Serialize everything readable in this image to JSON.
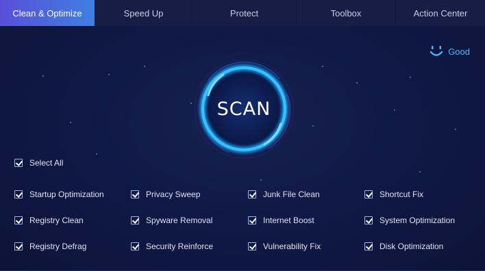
{
  "tabs": [
    {
      "label": "Clean & Optimize"
    },
    {
      "label": "Speed Up"
    },
    {
      "label": "Protect"
    },
    {
      "label": "Toolbox"
    },
    {
      "label": "Action Center"
    }
  ],
  "status": {
    "label": "Good",
    "icon": "smiley-icon",
    "color": "#4fb6ff"
  },
  "scan": {
    "label": "SCAN"
  },
  "select_all": {
    "label": "Select All",
    "checked": true
  },
  "options": [
    {
      "label": "Startup Optimization",
      "checked": true
    },
    {
      "label": "Privacy Sweep",
      "checked": true
    },
    {
      "label": "Junk File Clean",
      "checked": true
    },
    {
      "label": "Shortcut Fix",
      "checked": true
    },
    {
      "label": "Registry Clean",
      "checked": true
    },
    {
      "label": "Spyware Removal",
      "checked": true
    },
    {
      "label": "Internet Boost",
      "checked": true
    },
    {
      "label": "System Optimization",
      "checked": true
    },
    {
      "label": "Registry Defrag",
      "checked": true
    },
    {
      "label": "Security Reinforce",
      "checked": true
    },
    {
      "label": "Vulnerability Fix",
      "checked": true
    },
    {
      "label": "Disk Optimization",
      "checked": true
    }
  ],
  "colors": {
    "accent_start": "#5a4fd8",
    "accent_end": "#3f7fe0",
    "ring": "#1fa8ff",
    "background": "#0d1636"
  }
}
